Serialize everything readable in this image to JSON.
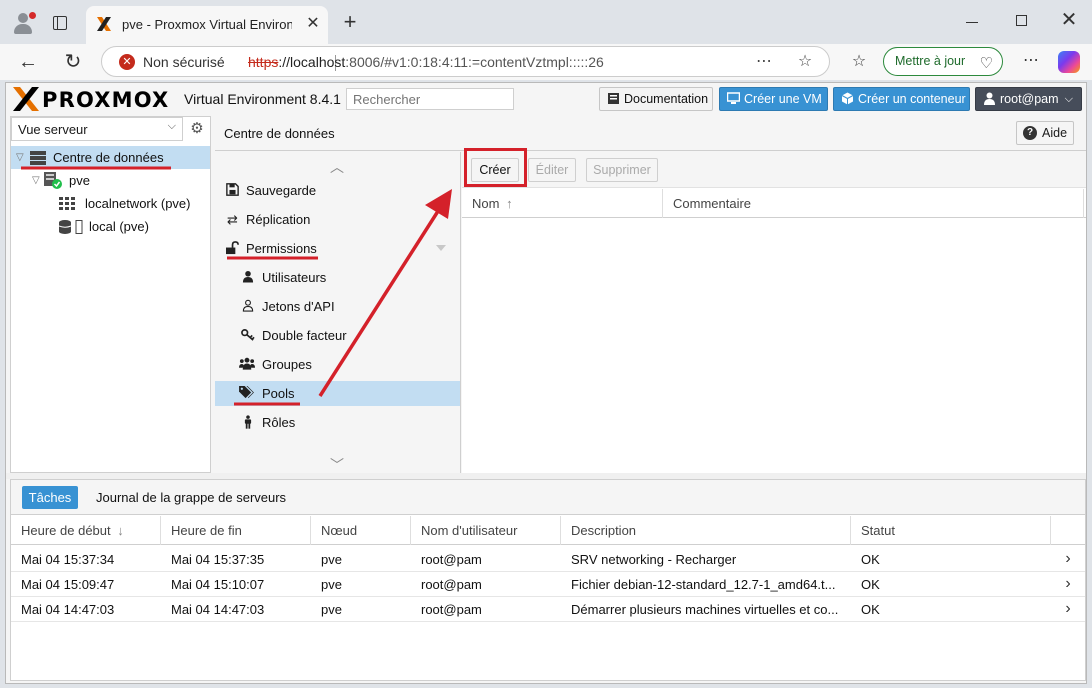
{
  "browser": {
    "tab_title": "pve - Proxmox Virtual Environmen",
    "tab_close": "✕",
    "new_tab": "+",
    "insecure_label": "Non sécurisé",
    "url_scheme": "https",
    "url_rest_host": "://localhost",
    "url_path": ":8006/#v1:0:18:4:11:=contentVztmpl:::::26",
    "update_label": "Mettre à jour"
  },
  "pve": {
    "logo_text": "PROXMOX",
    "version": "Virtual Environment 8.4.1",
    "search_placeholder": "Rechercher",
    "documentation_label": "Documentation",
    "create_vm_label": "Créer une VM",
    "create_ct_label": "Créer un conteneur",
    "user_label": "root@pam"
  },
  "left_panel": {
    "view_label": "Vue serveur",
    "tree": [
      {
        "label": "Centre de données"
      },
      {
        "label": "pve"
      },
      {
        "label": "localnetwork (pve)"
      },
      {
        "label": "local (pve)"
      }
    ]
  },
  "main": {
    "title": "Centre de données",
    "help_label": "Aide",
    "menu": [
      {
        "label": "Sauvegarde",
        "icon": "floppy-icon"
      },
      {
        "label": "Réplication",
        "icon": "retweet-icon"
      },
      {
        "label": "Permissions",
        "icon": "unlock-icon"
      },
      {
        "label": "Utilisateurs",
        "icon": "user-icon"
      },
      {
        "label": "Jetons d'API",
        "icon": "user-outline-icon"
      },
      {
        "label": "Double facteur",
        "icon": "key-icon"
      },
      {
        "label": "Groupes",
        "icon": "users-icon"
      },
      {
        "label": "Pools",
        "icon": "tags-icon"
      },
      {
        "label": "Rôles",
        "icon": "male-icon"
      }
    ],
    "toolbar": {
      "create_label": "Créer",
      "edit_label": "Éditer",
      "delete_label": "Supprimer"
    },
    "grid_headers": {
      "name": "Nom",
      "comment": "Commentaire"
    }
  },
  "tasks": {
    "tab_active": "Tâches",
    "tab_cluster_log": "Journal de la grappe de serveurs",
    "headers": {
      "start": "Heure de début",
      "end": "Heure de fin",
      "node": "Nœud",
      "user": "Nom d'utilisateur",
      "description": "Description",
      "status": "Statut"
    },
    "rows": [
      {
        "start": "Mai 04 15:37:34",
        "end": "Mai 04 15:37:35",
        "node": "pve",
        "user": "root@pam",
        "description": "SRV networking - Recharger",
        "status": "OK"
      },
      {
        "start": "Mai 04 15:09:47",
        "end": "Mai 04 15:10:07",
        "node": "pve",
        "user": "root@pam",
        "description": "Fichier debian-12-standard_12.7-1_amd64.t...",
        "status": "OK"
      },
      {
        "start": "Mai 04 14:47:03",
        "end": "Mai 04 14:47:03",
        "node": "pve",
        "user": "root@pam",
        "description": "Démarrer plusieurs machines virtuelles et co...",
        "status": "OK"
      }
    ]
  },
  "colors": {
    "accent": "#3892d3",
    "selection": "#c2ddf2",
    "annotation": "#d4212a"
  }
}
